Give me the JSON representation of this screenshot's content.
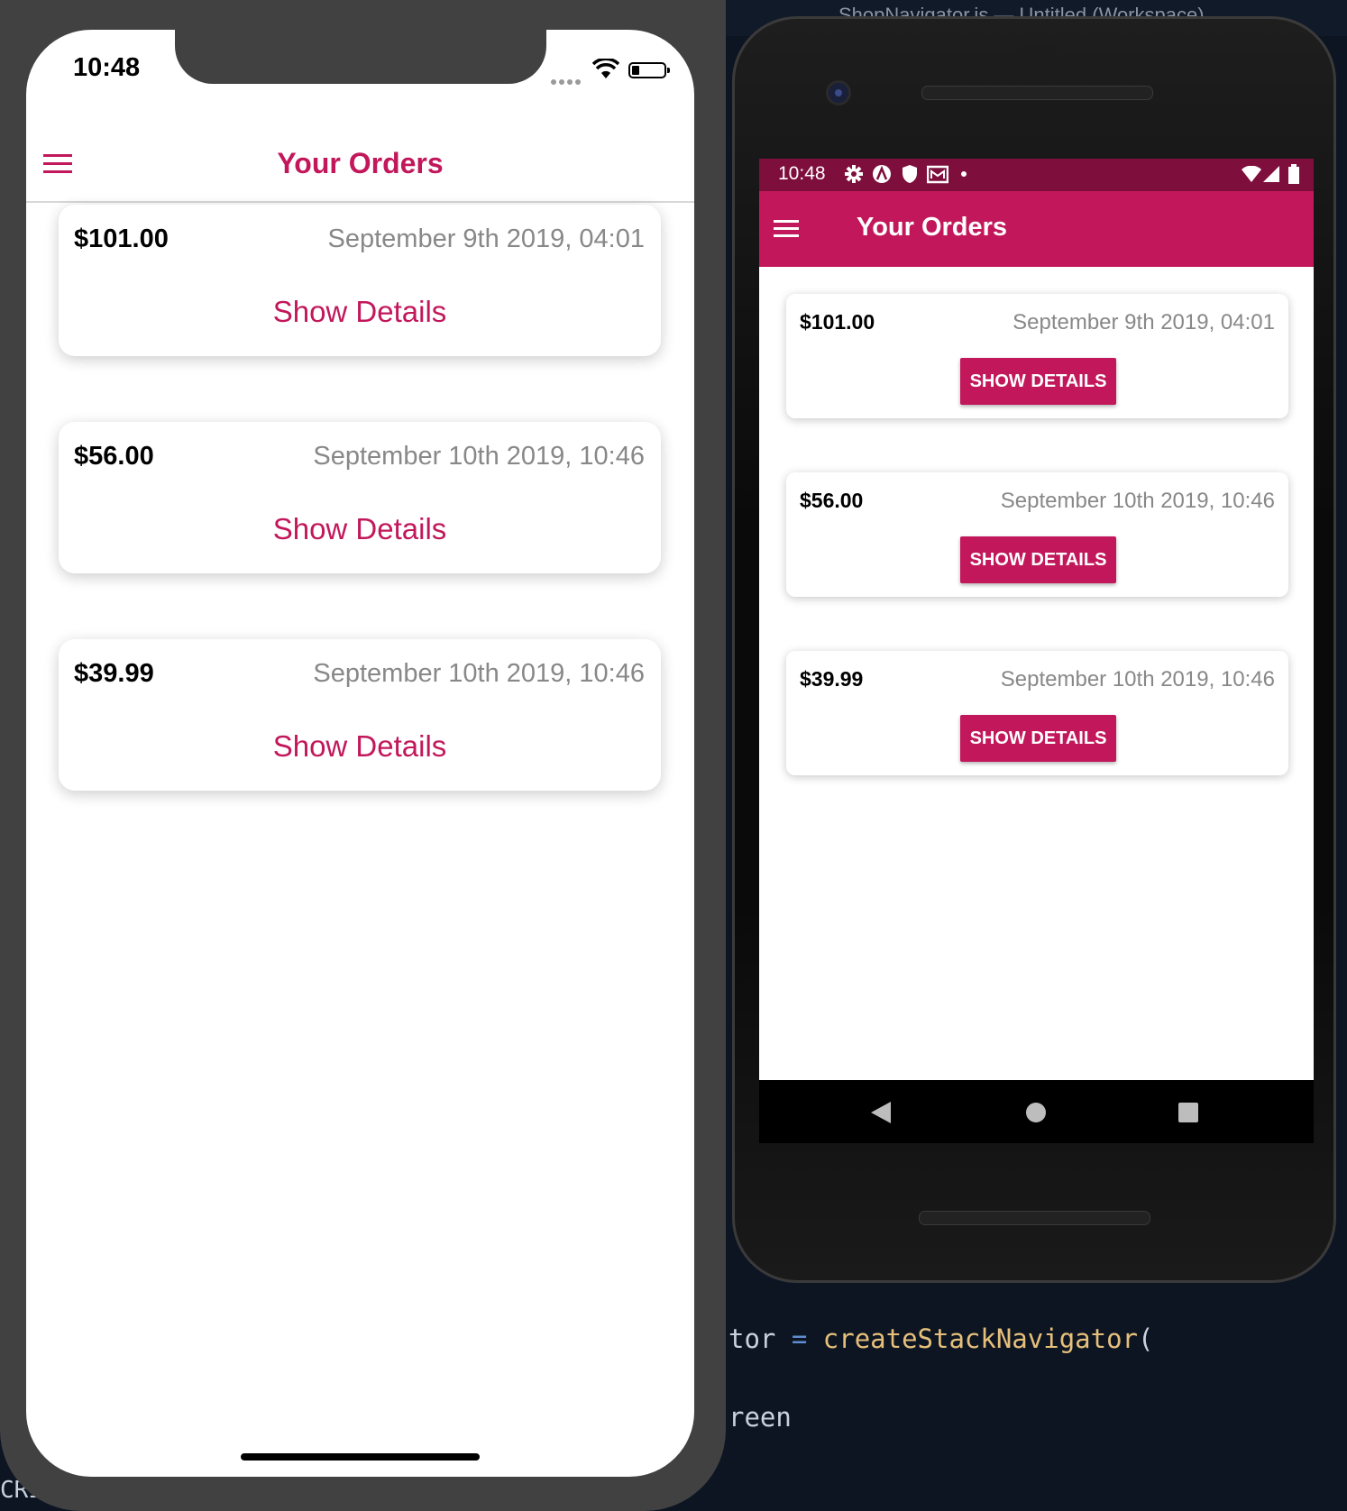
{
  "editor": {
    "title": "ShopNavigator.js — Untitled (Workspace)",
    "code_line1": {
      "ident": "tor",
      "op": "=",
      "fn": "createStackNavigator",
      "punc": "("
    },
    "code_line2": "reen",
    "code_left": "CRII"
  },
  "ios": {
    "status_time": "10:48",
    "header_title": "Your Orders",
    "orders": [
      {
        "amount": "$101.00",
        "date": "September 9th 2019, 04:01",
        "details_label": "Show Details"
      },
      {
        "amount": "$56.00",
        "date": "September 10th 2019, 10:46",
        "details_label": "Show Details"
      },
      {
        "amount": "$39.99",
        "date": "September 10th 2019, 10:46",
        "details_label": "Show Details"
      }
    ]
  },
  "android": {
    "status_time": "10:48",
    "status_icons": [
      "gear-icon",
      "a-circle-icon",
      "shield-icon",
      "mail-icon",
      "dot-icon"
    ],
    "status_right_icons": [
      "wifi-icon",
      "signal-icon",
      "battery-icon"
    ],
    "header_title": "Your Orders",
    "orders": [
      {
        "amount": "$101.00",
        "date": "September 9th 2019, 04:01",
        "details_label": "SHOW DETAILS"
      },
      {
        "amount": "$56.00",
        "date": "September 10th 2019, 10:46",
        "details_label": "SHOW DETAILS"
      },
      {
        "amount": "$39.99",
        "date": "September 10th 2019, 10:46",
        "details_label": "SHOW DETAILS"
      }
    ],
    "nav_buttons": [
      "back-icon",
      "home-icon",
      "recents-icon"
    ]
  },
  "colors": {
    "accent": "#c2185b",
    "android_statusbar": "#7e0e3c",
    "date_text": "#888888"
  }
}
